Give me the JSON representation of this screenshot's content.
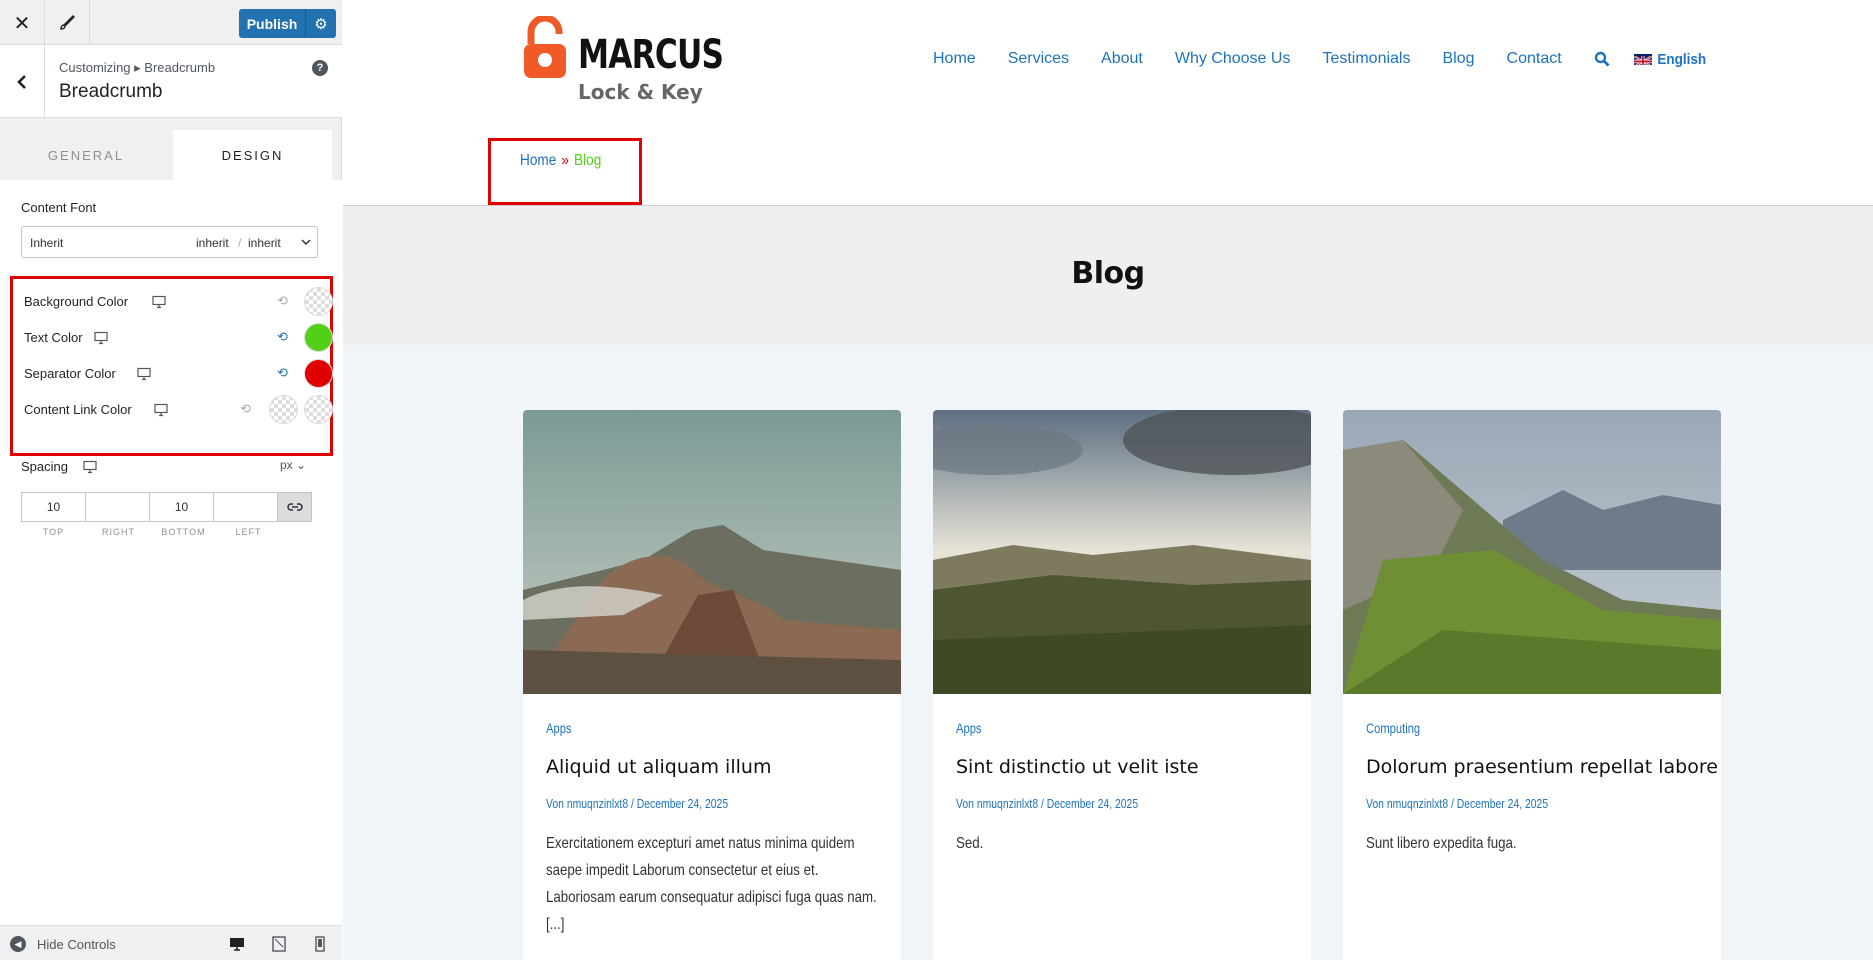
{
  "customizer": {
    "publish_label": "Publish",
    "breadcrumb_path": "Customizing ▸ Breadcrumb",
    "section_title": "Breadcrumb",
    "tabs": [
      {
        "label": "GENERAL",
        "active": false
      },
      {
        "label": "DESIGN",
        "active": true
      }
    ],
    "content_font": {
      "label": "Content Font",
      "family": "Inherit",
      "weight": "inherit",
      "style": "inherit"
    },
    "colors": [
      {
        "label": "Background Color",
        "value": "",
        "active": false
      },
      {
        "label": "Text Color",
        "value": "#52d017",
        "active": true
      },
      {
        "label": "Separator Color",
        "value": "#e00000",
        "active": true
      },
      {
        "label": "Content Link Color",
        "value": "",
        "second_value": "",
        "active": false
      }
    ],
    "spacing": {
      "label": "Spacing",
      "unit": "px",
      "top": "10",
      "right": "",
      "bottom": "10",
      "left": "",
      "labels": [
        "TOP",
        "RIGHT",
        "BOTTOM",
        "LEFT"
      ]
    },
    "footer": {
      "hide_controls_label": "Hide Controls"
    }
  },
  "site": {
    "logo": {
      "name": "MARCUS",
      "tagline": "Lock & Key",
      "color": "#f05a28"
    },
    "nav": [
      "Home",
      "Services",
      "About",
      "Why Choose Us",
      "Testimonials",
      "Blog",
      "Contact"
    ],
    "language": "English",
    "breadcrumb": {
      "home": "Home",
      "separator": "»",
      "current": "Blog"
    },
    "page_title": "Blog",
    "posts": [
      {
        "category": "Apps",
        "title": "Aliquid ut aliquam illum",
        "meta": "Von nmuqnzinlxt8 / December 24, 2025",
        "excerpt": "Exercitationem excepturi amet natus minima quidem saepe impedit Laborum consectetur et eius et. Laboriosam earum consequatur adipisci fuga quas nam. [...]"
      },
      {
        "category": "Apps",
        "title": "Sint distinctio ut velit iste",
        "meta": "Von nmuqnzinlxt8 / December 24, 2025",
        "excerpt": "Sed."
      },
      {
        "category": "Computing",
        "title": "Dolorum praesentium repellat labore",
        "meta": "Von nmuqnzinlxt8 / December 24, 2025",
        "excerpt": "Sunt libero expedita fuga."
      }
    ]
  }
}
